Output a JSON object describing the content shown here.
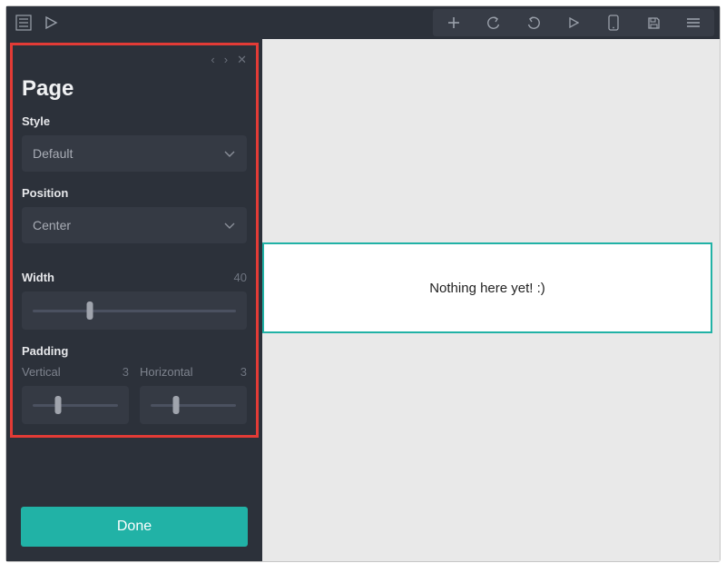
{
  "toolbar": {
    "icons": [
      "menu-icon",
      "play-icon"
    ],
    "right_icons": [
      "plus-icon",
      "undo-icon",
      "redo-icon",
      "play-small-icon",
      "device-icon",
      "save-icon",
      "hamburger-icon"
    ]
  },
  "panel": {
    "title": "Page",
    "nav": {
      "prev": "‹",
      "next": "›",
      "close": "✕"
    },
    "style": {
      "label": "Style",
      "value": "Default"
    },
    "position": {
      "label": "Position",
      "value": "Center"
    },
    "width": {
      "label": "Width",
      "value": 40,
      "percent": 28
    },
    "padding": {
      "label": "Padding",
      "vertical_label": "Vertical",
      "vertical_value": 3,
      "vertical_percent": 30,
      "horizontal_label": "Horizontal",
      "horizontal_value": 3,
      "horizontal_percent": 30
    },
    "done_label": "Done"
  },
  "canvas": {
    "placeholder": "Nothing here yet! :)"
  },
  "colors": {
    "accent": "#21b2a6",
    "panel_bg": "#2c313a",
    "highlight_border": "#e33b36"
  }
}
